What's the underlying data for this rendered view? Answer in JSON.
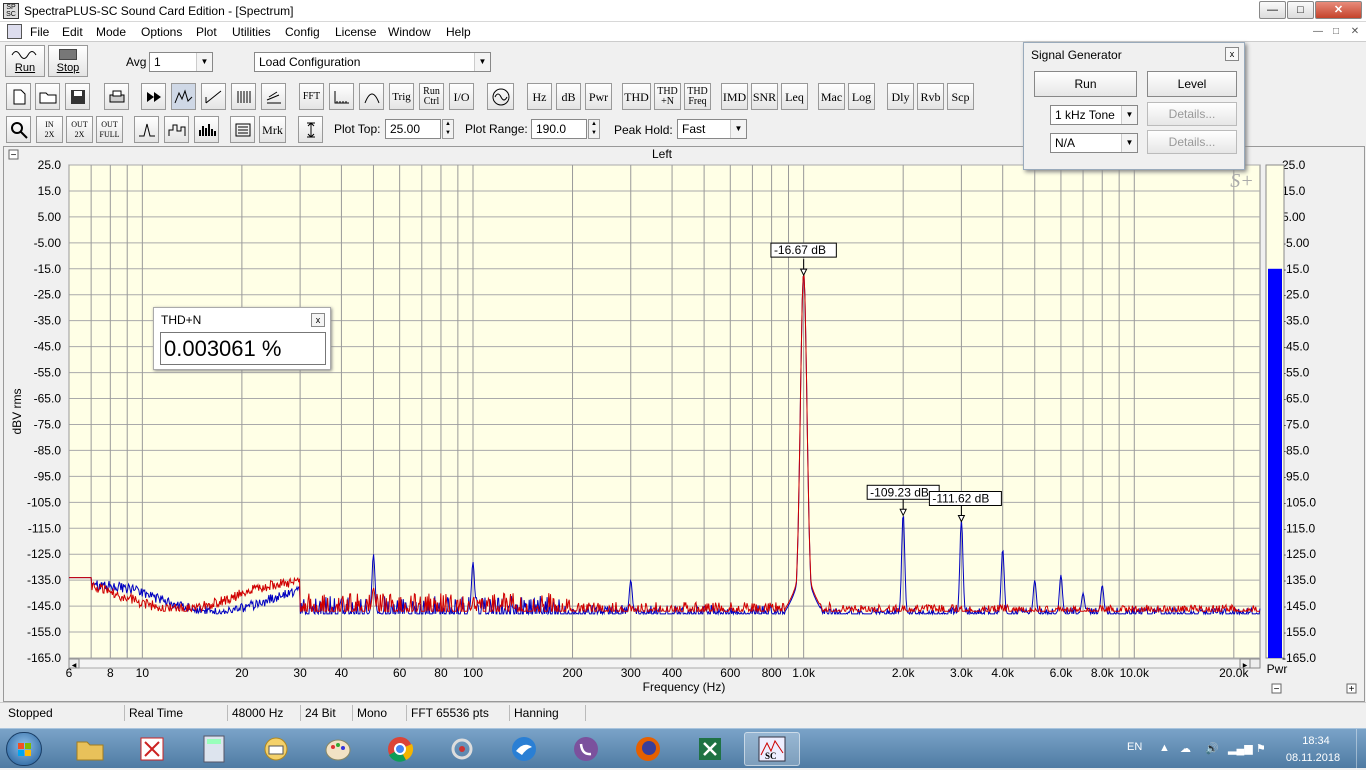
{
  "window": {
    "title": "SpectraPLUS-SC Sound Card Edition - [Spectrum]",
    "min": "—",
    "max": "□",
    "close": "✕"
  },
  "menu": {
    "items": [
      "File",
      "Edit",
      "Mode",
      "Options",
      "Plot",
      "Utilities",
      "Config",
      "License",
      "Window",
      "Help"
    ]
  },
  "toolbar1": {
    "run_label": "Run",
    "stop_label": "Stop",
    "avg_label": "Avg",
    "avg_value": "1",
    "config_value": "Load Configuration"
  },
  "toolbar2": {
    "fft": "FFT",
    "trig": "Trig",
    "run_ctrl_1": "Run",
    "run_ctrl_2": "Ctrl",
    "io": "I/O",
    "hz": "Hz",
    "db": "dB",
    "pwr": "Pwr",
    "thd": "THD",
    "thdn_1": "THD",
    "thdn_2": "+N",
    "thdf_1": "THD",
    "thdf_2": "Freq",
    "imd": "IMD",
    "snr": "SNR",
    "leq": "Leq",
    "mac": "Mac",
    "log": "Log",
    "dly": "Dly",
    "rvb": "Rvb",
    "scp": "Scp"
  },
  "toolbar3": {
    "in2x_1": "IN",
    "in2x_2": "2X",
    "out2x_1": "OUT",
    "out2x_2": "2X",
    "outfull_1": "OUT",
    "outfull_2": "FULL",
    "mrk": "Mrk",
    "plot_top_label": "Plot Top:",
    "plot_top_value": "25.00",
    "plot_range_label": "Plot Range:",
    "plot_range_value": "190.0",
    "peak_hold_label": "Peak Hold:",
    "peak_hold_value": "Fast"
  },
  "plot": {
    "collapse": "−",
    "collapse_bottom": "−",
    "expand_right": "+",
    "channel_title": "Left",
    "y_axis_label": "dBV rms",
    "x_axis_label": "Frequency (Hz)",
    "bar_label": "Pwr",
    "logo": "S+",
    "markers": [
      {
        "freq": 1000,
        "db": -16.67,
        "label": "-16.67 dB"
      },
      {
        "freq": 2000,
        "db": -109.23,
        "label": "-109.23 dB"
      },
      {
        "freq": 3000,
        "db": -111.62,
        "label": "-111.62 dB"
      }
    ]
  },
  "chart_data": {
    "type": "line",
    "title": "Left",
    "xlabel": "Frequency (Hz)",
    "ylabel": "dBV rms",
    "x_scale": "log",
    "xlim": [
      6,
      24000
    ],
    "ylim": [
      -165,
      25
    ],
    "y_ticks": [
      "25.0",
      "15.0",
      "5.00",
      "-5.00",
      "-15.0",
      "-25.0",
      "-35.0",
      "-45.0",
      "-55.0",
      "-65.0",
      "-75.0",
      "-85.0",
      "-95.0",
      "-105.0",
      "-115.0",
      "-125.0",
      "-135.0",
      "-145.0",
      "-155.0",
      "-165.0"
    ],
    "x_ticks": [
      {
        "v": 6,
        "label": "6"
      },
      {
        "v": 8,
        "label": "8"
      },
      {
        "v": 10,
        "label": "10"
      },
      {
        "v": 20,
        "label": "20"
      },
      {
        "v": 30,
        "label": "30"
      },
      {
        "v": 40,
        "label": "40"
      },
      {
        "v": 60,
        "label": "60"
      },
      {
        "v": 80,
        "label": "80"
      },
      {
        "v": 100,
        "label": "100"
      },
      {
        "v": 200,
        "label": "200"
      },
      {
        "v": 300,
        "label": "300"
      },
      {
        "v": 400,
        "label": "400"
      },
      {
        "v": 600,
        "label": "600"
      },
      {
        "v": 800,
        "label": "800"
      },
      {
        "v": 1000,
        "label": "1.0k"
      },
      {
        "v": 2000,
        "label": "2.0k"
      },
      {
        "v": 3000,
        "label": "3.0k"
      },
      {
        "v": 4000,
        "label": "4.0k"
      },
      {
        "v": 6000,
        "label": "6.0k"
      },
      {
        "v": 8000,
        "label": "8.0k"
      },
      {
        "v": 10000,
        "label": "10.0k"
      },
      {
        "v": 20000,
        "label": "20.0k"
      }
    ],
    "grid": true,
    "series": [
      {
        "color": "#0000c0",
        "noise_floor": -148,
        "peaks": [
          {
            "x": 50,
            "y": -125
          },
          {
            "x": 100,
            "y": -128
          },
          {
            "x": 300,
            "y": -135
          },
          {
            "x": 1000,
            "y": -16.67
          },
          {
            "x": 2000,
            "y": -109.23
          },
          {
            "x": 3000,
            "y": -111.62
          },
          {
            "x": 4000,
            "y": -123
          },
          {
            "x": 5000,
            "y": -135
          },
          {
            "x": 6000,
            "y": -133
          },
          {
            "x": 7000,
            "y": -140
          },
          {
            "x": 8000,
            "y": -137
          }
        ]
      },
      {
        "color": "#d00000",
        "noise_floor": -147,
        "peaks": [
          {
            "x": 50,
            "y": -138
          },
          {
            "x": 100,
            "y": -145
          },
          {
            "x": 1000,
            "y": -16.67
          }
        ]
      }
    ],
    "bar_level_db": -15.0,
    "bar_color": "#0000ff"
  },
  "thdn_box": {
    "title": "THD+N",
    "value": "0.003061 %",
    "close": "x"
  },
  "signal_generator": {
    "title": "Signal Generator",
    "close": "x",
    "run": "Run",
    "level": "Level",
    "waveform": "1 kHz Tone",
    "details1": "Details...",
    "channel": "N/A",
    "details2": "Details..."
  },
  "status": {
    "state": "Stopped",
    "mode": "Real Time",
    "rate": "48000 Hz",
    "bits": "24 Bit",
    "channels": "Mono",
    "fft": "FFT 65536 pts",
    "window": "Hanning"
  },
  "taskbar": {
    "lang": "EN",
    "time": "18:34",
    "date": "08.11.2018",
    "apps": [
      "explorer-icon",
      "app-red-icon",
      "calculator-icon",
      "mail-icon",
      "paint-icon",
      "chrome-icon",
      "app-gear-icon",
      "app-bird-icon",
      "viber-icon",
      "firefox-icon",
      "excel-icon",
      "spectraplus-icon"
    ]
  }
}
